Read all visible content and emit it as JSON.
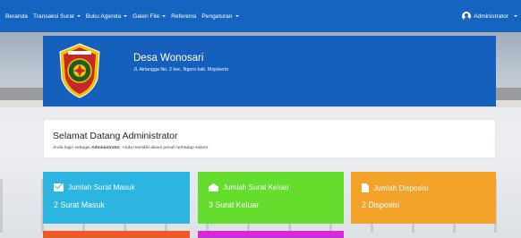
{
  "navbar": {
    "items": [
      {
        "label": "Beranda",
        "dropdown": false
      },
      {
        "label": "Transaksi Surat",
        "dropdown": true
      },
      {
        "label": "Buku Agenda",
        "dropdown": true
      },
      {
        "label": "Galeri File",
        "dropdown": true
      },
      {
        "label": "Referensi",
        "dropdown": false
      },
      {
        "label": "Pengaturan",
        "dropdown": true
      }
    ],
    "user": {
      "label": "Administrator",
      "icon": "user-circle-icon"
    }
  },
  "banner": {
    "org_name": "Desa Wonosari",
    "address": "Jl. Airlangga No. 2 kec. Ngoro kab. Mojokerto",
    "logo_icon": "village-emblem-icon"
  },
  "welcome": {
    "title": "Selamat Datang Administrator",
    "text_prefix": "Anda login sebagai ",
    "text_role": "Administrator",
    "text_suffix": ". Anda memiliki akses penuh terhadap sistem."
  },
  "stats": [
    {
      "title": "Jumlah Surat Masuk",
      "value": "2 Surat Masuk",
      "icon": "envelope-icon",
      "color": "#2bb5e0"
    },
    {
      "title": "Jumlah Surat Keluar",
      "value": "3 Surat Keluar",
      "icon": "envelope-open-icon",
      "color": "#64dd2d"
    },
    {
      "title": "Jumlah Disposisi",
      "value": "2 Disposisi",
      "icon": "file-icon",
      "color": "#f3a22a"
    }
  ],
  "colors": {
    "navbar": "#1565c0",
    "banner": "#1660bd",
    "partial_red": "#f05a2a",
    "partial_purple": "#d42ad8"
  }
}
